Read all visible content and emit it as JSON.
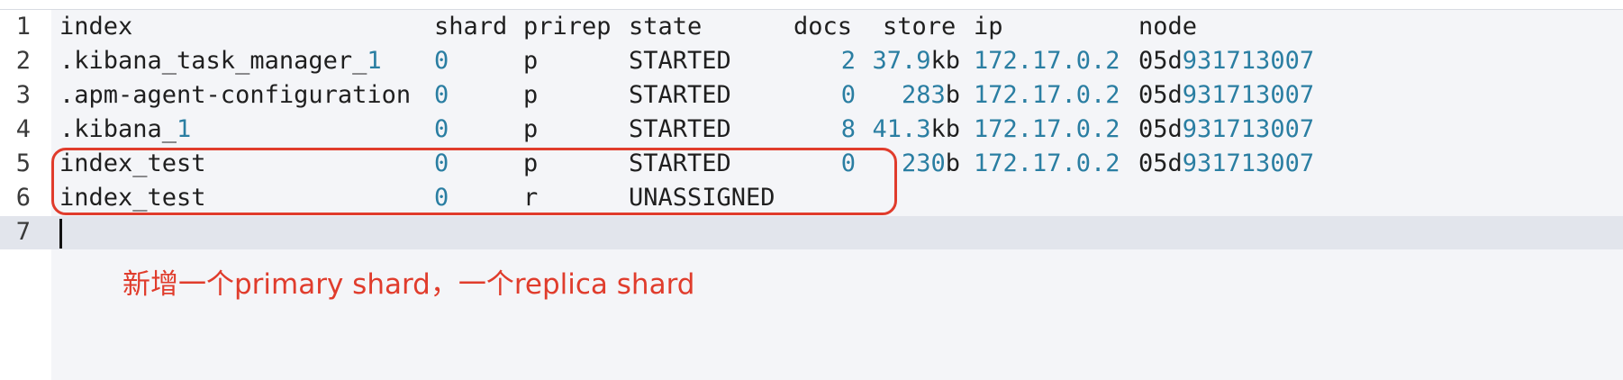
{
  "editor": {
    "line_numbers": [
      "1",
      "2",
      "3",
      "4",
      "5",
      "6",
      "7"
    ],
    "header": {
      "index": "index",
      "shard": "shard",
      "prirep": "prirep",
      "state": "state",
      "docs": "docs",
      "store": "store",
      "ip": "ip",
      "node": "node"
    },
    "rows": [
      {
        "index_text": ".kibana_task_manager_",
        "index_num": "1",
        "shard": "0",
        "prirep": "p",
        "state": "STARTED",
        "docs": "2",
        "store_num": "37.9",
        "store_unit": "kb",
        "ip": "172.17.0.2",
        "node_prefix": "05d",
        "node_num": "931713007"
      },
      {
        "index_text": ".apm-agent-configuration",
        "index_num": "",
        "shard": "0",
        "prirep": "p",
        "state": "STARTED",
        "docs": "0",
        "store_num": "283",
        "store_unit": "b",
        "ip": "172.17.0.2",
        "node_prefix": "05d",
        "node_num": "931713007"
      },
      {
        "index_text": ".kibana_",
        "index_num": "1",
        "shard": "0",
        "prirep": "p",
        "state": "STARTED",
        "docs": "8",
        "store_num": "41.3",
        "store_unit": "kb",
        "ip": "172.17.0.2",
        "node_prefix": "05d",
        "node_num": "931713007"
      },
      {
        "index_text": "index_test",
        "index_num": "",
        "shard": "0",
        "prirep": "p",
        "state": "STARTED",
        "docs": "0",
        "store_num": "230",
        "store_unit": "b",
        "ip": "172.17.0.2",
        "node_prefix": "05d",
        "node_num": "931713007"
      },
      {
        "index_text": "index_test",
        "index_num": "",
        "shard": "0",
        "prirep": "r",
        "state": "UNASSIGNED",
        "docs": "",
        "store_num": "",
        "store_unit": "",
        "ip": "",
        "node_prefix": "",
        "node_num": ""
      }
    ]
  },
  "annotation": {
    "text": "新增一个primary shard，一个replica shard"
  },
  "colors": {
    "number": "#2a7ea2",
    "annotation_red": "#e03c2c",
    "current_line": "#e2e5ec"
  }
}
